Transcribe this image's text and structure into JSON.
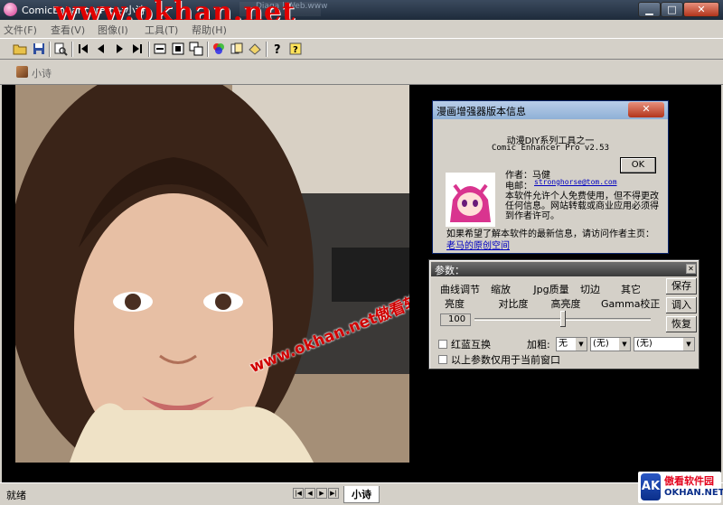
{
  "window": {
    "title": "ComicEnhancerPro - 小诗",
    "watermark": "www.okhan.net",
    "background_window_title": "Diaga | Web.www",
    "buttons": {
      "minimize": "▁",
      "maximize": "□",
      "close": "✕"
    }
  },
  "menu": [
    "文件(F)",
    "查看(V)",
    "图像(I)",
    "工具(T)",
    "帮助(H)"
  ],
  "toolbar": {
    "icons": [
      "open-folder-icon",
      "save-icon",
      "browse-icon",
      "first-page-icon",
      "prev-page-icon",
      "next-page-icon",
      "last-page-icon",
      "fit-width-icon",
      "fit-page-icon",
      "multi-window-icon",
      "color-icon",
      "batch-icon",
      "settings-icon",
      "help-icon",
      "about-icon"
    ]
  },
  "document_tab": {
    "label": "小诗"
  },
  "photo_watermark": "www.okhan.net傲看软件园",
  "about_dialog": {
    "title": "漫画增强器版本信息",
    "line1": "动漫DIY系列工具之一",
    "line2": "Comic Enhancer Pro v2.53",
    "ok_label": "OK",
    "author": "作者：马健",
    "email_label": "电邮：",
    "email": "stronghorse@tom.com",
    "license": "本软件允许个人免费使用，但不得更改任何信息。网站转载或商业应用必须得到作者许可。",
    "update_text": "如果希望了解本软件的最新信息，请访问作者主页：",
    "homepage_link": "老马的原创空间"
  },
  "params_panel": {
    "title": "参数：",
    "tabs_upper": [
      "曲线调节",
      "缩放",
      "Jpg质量",
      "切边",
      "其它"
    ],
    "tabs_lower": [
      "亮度",
      "对比度",
      "高亮度",
      "Gamma校正"
    ],
    "value": "100",
    "slider_level": 0.5,
    "buttons": {
      "save": "保存",
      "load": "调入",
      "restore": "恢复"
    },
    "red_blue_swap": "红蓝互换",
    "bold_label": "加粗:",
    "bold_value": "无",
    "combo2": "(无)",
    "combo3": "(无)",
    "current_only": "以上参数仅用于当前窗口"
  },
  "status": {
    "text": "就绪",
    "nav": [
      "|◀",
      "◀",
      "▶",
      "▶|"
    ],
    "tab": "小诗"
  },
  "site_logo": {
    "mark": "AK",
    "cn": "傲看软件园",
    "en": "OKHAN.NET"
  }
}
